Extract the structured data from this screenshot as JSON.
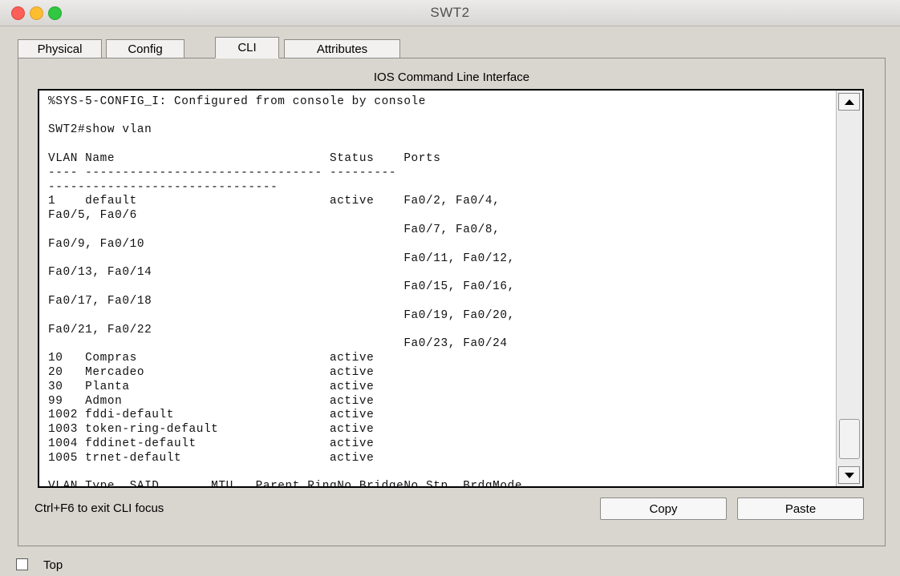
{
  "window": {
    "title": "SWT2"
  },
  "tabs": [
    {
      "label": "Physical",
      "active": false
    },
    {
      "label": "Config",
      "active": false
    },
    {
      "label": "CLI",
      "active": true
    },
    {
      "label": "Attributes",
      "active": false
    }
  ],
  "cli": {
    "header": "IOS Command Line Interface",
    "output": "SWT2#\n%SYS-5-CONFIG_I: Configured from console by console\n\nSWT2#show vlan\n\nVLAN Name                             Status    Ports\n---- -------------------------------- ---------\n-------------------------------\n1    default                          active    Fa0/2, Fa0/4,\nFa0/5, Fa0/6\n                                                Fa0/7, Fa0/8,\nFa0/9, Fa0/10\n                                                Fa0/11, Fa0/12,\nFa0/13, Fa0/14\n                                                Fa0/15, Fa0/16,\nFa0/17, Fa0/18\n                                                Fa0/19, Fa0/20,\nFa0/21, Fa0/22\n                                                Fa0/23, Fa0/24\n10   Compras                          active\n20   Mercadeo                         active\n30   Planta                           active\n99   Admon                            active\n1002 fddi-default                     active\n1003 token-ring-default               active\n1004 fddinet-default                  active\n1005 trnet-default                    active\n\nVLAN Type  SAID       MTU   Parent RingNo BridgeNo Stp  BrdgMode",
    "hint": "Ctrl+F6 to exit CLI focus",
    "copy_label": "Copy",
    "paste_label": "Paste"
  },
  "footer": {
    "top_label": "Top",
    "top_checked": false
  },
  "colors": {
    "close": "#fb5f57",
    "minimize": "#fdbd2e",
    "maximize": "#2fc840",
    "window_bg": "#d9d6cf",
    "terminal_bg": "#ffffff"
  }
}
